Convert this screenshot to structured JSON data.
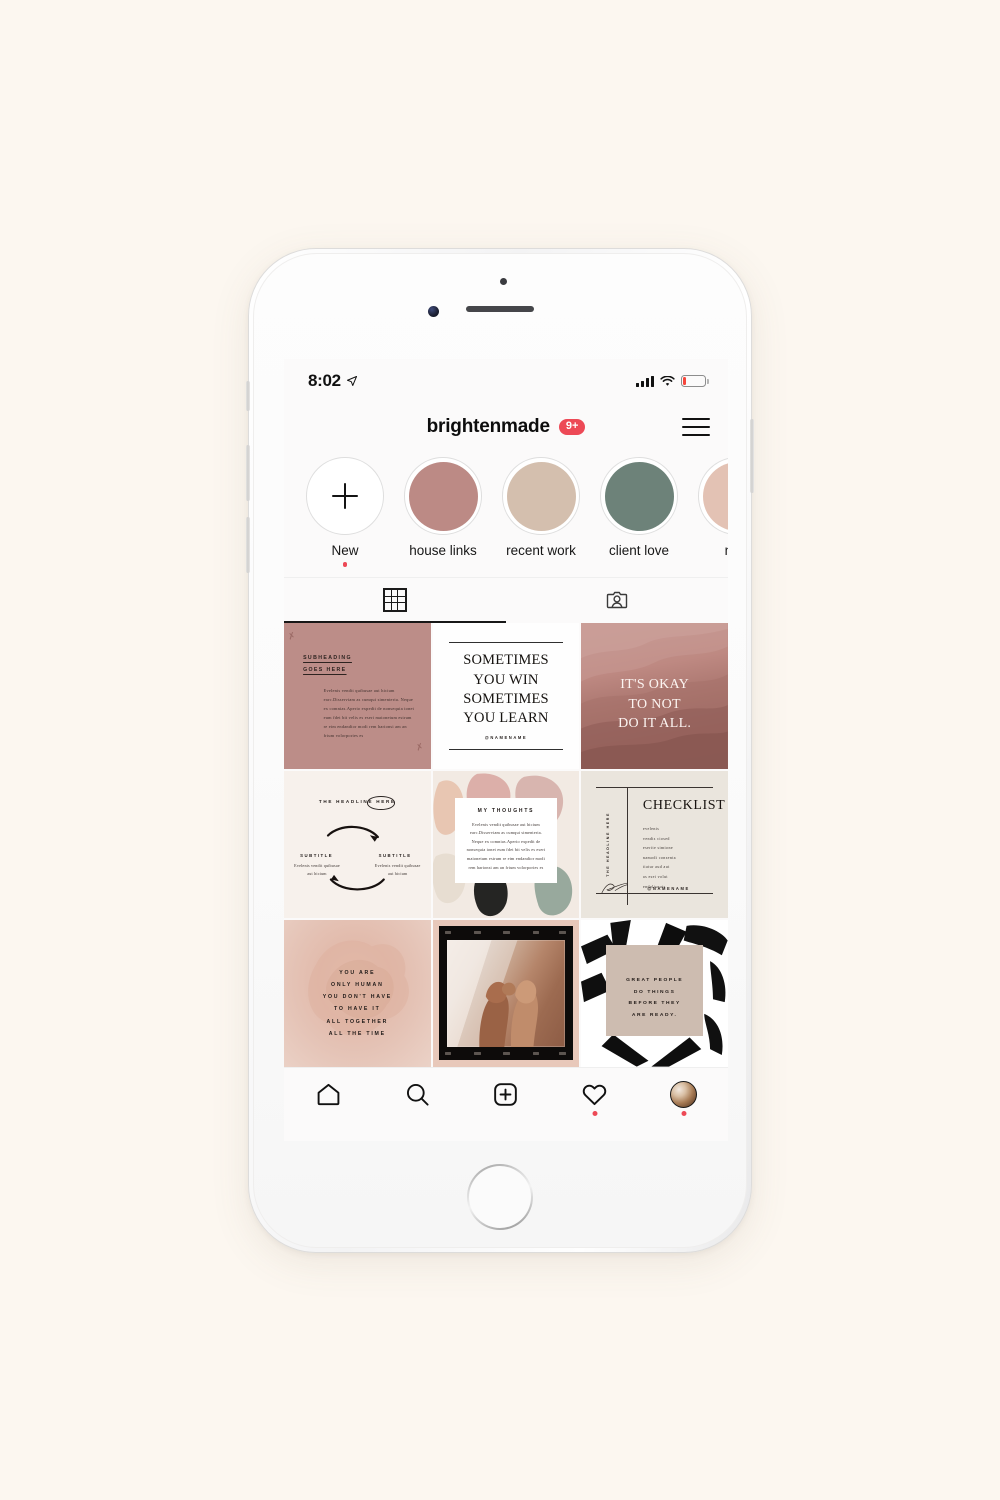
{
  "device": {
    "name": "iphone-white"
  },
  "status_bar": {
    "time": "8:02",
    "location_icon": "location-arrow-icon",
    "signal_icon": "cellular-bars-icon",
    "wifi_icon": "wifi-icon",
    "battery_icon": "battery-low-icon",
    "battery_color": "#F6463B"
  },
  "header": {
    "username": "brightenmade",
    "badge": "9+",
    "badge_color": "#ED4956",
    "menu_icon": "hamburger-menu-icon"
  },
  "highlights": [
    {
      "label": "New",
      "icon": "plus-icon",
      "color": "#ffffff",
      "has_dot": true
    },
    {
      "label": "house links",
      "color": "#BC8A85",
      "has_dot": false
    },
    {
      "label": "recent work",
      "color": "#D4BFAE",
      "has_dot": false
    },
    {
      "label": "client love",
      "color": "#6D8279",
      "has_dot": false
    },
    {
      "label": "new",
      "color": "#E3C2B4",
      "has_dot": false
    }
  ],
  "tabs": [
    {
      "icon": "grid-icon",
      "active": true
    },
    {
      "icon": "tagged-person-icon",
      "active": false
    }
  ],
  "posts": [
    {
      "id": "post-subheading",
      "type": "text-rose",
      "subheading_line1": "SUBHEADING",
      "subheading_line2": "GOES HERE",
      "body": "Evelenis vendit quibusae aut hicium earc.Disserviam as cumqui simenteria. Neque ex comnias.Aperio expedit de nonsequia ionet eum fdet bit velis es eseri maionetum estrum re eim endandior modi rem harionsi am an frium volorpories es"
    },
    {
      "id": "post-sometimes",
      "type": "quote-white",
      "line1": "SOMETIMES",
      "line2": "YOU WIN",
      "line3": "SOMETIMES",
      "line4": "YOU LEARN",
      "handle": "@NAMENAME"
    },
    {
      "id": "post-its-okay",
      "type": "quote-watercolor",
      "line1": "IT'S OKAY",
      "line2": "TO NOT",
      "line3": "DO IT ALL."
    },
    {
      "id": "post-headline-cycle",
      "type": "diagram-cream",
      "headline": "THE HEADLINE",
      "headline_circled": "HERE",
      "subtitle_left": "SUBTITLE",
      "subtitle_right": "SUBTITLE",
      "body_left": "Evelenis vendit quibusae aut hicium",
      "body_right": "Evelenis vendit quibusae aut hicium"
    },
    {
      "id": "post-my-thoughts",
      "type": "card-brushstroke",
      "title": "MY THOUGHTS",
      "body": "Evelenis vendit quibusae aut hicium earc.Disserviam as cumqui simenteria. Neque ex comnias.Aperio expedit de nonsequia ionet eum fdet bit velis es eseri maionetum estrum re eim endandior modi rem harionsi am an frium volorpories es"
    },
    {
      "id": "post-checklist",
      "type": "checklist-beige",
      "title": "CHECKLIST",
      "vertical_label": "THE HEADLINE HERE",
      "items": [
        "evelenis",
        "vendis ciosed",
        "eserite simione",
        "namodi consenta",
        "tiatur aud aut",
        "as esei volut",
        "endolisquis"
      ],
      "handle": "@NAMENAME",
      "signature_icon": "signature-icon"
    },
    {
      "id": "post-only-human",
      "type": "quote-blush",
      "line1": "YOU ARE",
      "line2": "ONLY HUMAN",
      "line3": "YOU DON'T HAVE",
      "line4": "TO HAVE IT",
      "line5": "ALL TOGETHER",
      "line6": "ALL THE TIME"
    },
    {
      "id": "post-pinky-promise",
      "type": "photo-film",
      "description": "two hands pinky promise photo in film frame"
    },
    {
      "id": "post-great-people",
      "type": "quote-brushstroke",
      "line1": "GREAT PEOPLE",
      "line2": "DO THINGS",
      "line3": "BEFORE THEY",
      "line4": "ARE READY."
    }
  ],
  "bottom_nav": [
    {
      "icon": "home-icon",
      "has_dot": false
    },
    {
      "icon": "search-icon",
      "has_dot": false
    },
    {
      "icon": "add-post-icon",
      "has_dot": false
    },
    {
      "icon": "heart-icon",
      "has_dot": true
    },
    {
      "icon": "profile-avatar-icon",
      "has_dot": true
    }
  ],
  "theme": {
    "background": "#FCF7F0",
    "accent_red": "#ED4956"
  }
}
